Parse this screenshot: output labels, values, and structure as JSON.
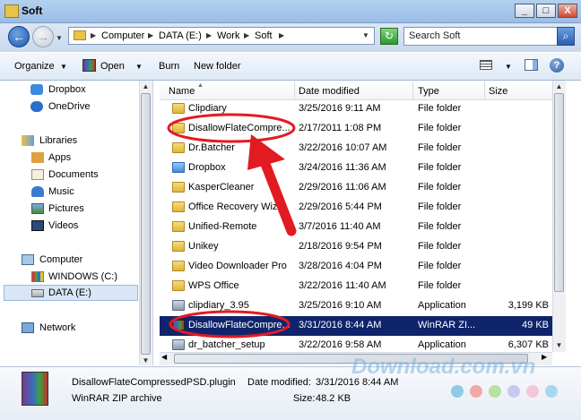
{
  "window": {
    "title": "Soft"
  },
  "titlebar_buttons": {
    "minimize": "_",
    "maximize": "□",
    "close": "X"
  },
  "address": {
    "breadcrumbs": [
      "Computer",
      "DATA (E:)",
      "Work",
      "Soft"
    ],
    "search_placeholder": "Search Soft"
  },
  "toolbar": {
    "organize": "Organize",
    "open": "Open",
    "burn": "Burn",
    "new_folder": "New folder",
    "help": "?"
  },
  "nav": {
    "favorites": [
      "Dropbox",
      "OneDrive"
    ],
    "libraries_label": "Libraries",
    "libraries": [
      "Apps",
      "Documents",
      "Music",
      "Pictures",
      "Videos"
    ],
    "computer_label": "Computer",
    "drives": [
      "WINDOWS (C:)",
      "DATA (E:)"
    ],
    "selected": "DATA (E:)",
    "network_label": "Network"
  },
  "columns": {
    "name": "Name",
    "date": "Date modified",
    "type": "Type",
    "size": "Size"
  },
  "files": [
    {
      "name": "Clipdiary",
      "date": "3/25/2016 9:11 AM",
      "type": "File folder",
      "size": "",
      "icon": "folder-icon"
    },
    {
      "name": "DisallowFlateCompre...",
      "date": "2/17/2011 1:08 PM",
      "type": "File folder",
      "size": "",
      "icon": "folder-icon"
    },
    {
      "name": "Dr.Batcher",
      "date": "3/22/2016 10:07 AM",
      "type": "File folder",
      "size": "",
      "icon": "folder-icon"
    },
    {
      "name": "Dropbox",
      "date": "3/24/2016 11:36 AM",
      "type": "File folder",
      "size": "",
      "icon": "dropbox-folder-icon"
    },
    {
      "name": "KasperCleaner",
      "date": "2/29/2016 11:06 AM",
      "type": "File folder",
      "size": "",
      "icon": "folder-icon"
    },
    {
      "name": "Office Recovery Wiz...",
      "date": "2/29/2016 5:44 PM",
      "type": "File folder",
      "size": "",
      "icon": "folder-icon"
    },
    {
      "name": "Unified-Remote",
      "date": "3/7/2016 11:40 AM",
      "type": "File folder",
      "size": "",
      "icon": "folder-icon"
    },
    {
      "name": "Unikey",
      "date": "2/18/2016 9:54 PM",
      "type": "File folder",
      "size": "",
      "icon": "folder-icon"
    },
    {
      "name": "Video Downloader Pro",
      "date": "3/28/2016 4:04 PM",
      "type": "File folder",
      "size": "",
      "icon": "folder-icon"
    },
    {
      "name": "WPS Office",
      "date": "3/22/2016 11:40 AM",
      "type": "File folder",
      "size": "",
      "icon": "folder-icon"
    },
    {
      "name": "clipdiary_3.95",
      "date": "3/25/2016 9:10 AM",
      "type": "Application",
      "size": "3,199 KB",
      "icon": "installer-icon"
    },
    {
      "name": "DisallowFlateCompre...",
      "date": "3/31/2016 8:44 AM",
      "type": "WinRAR ZI...",
      "size": "49 KB",
      "icon": "winrar-icon",
      "selected": true
    },
    {
      "name": "dr_batcher_setup",
      "date": "3/22/2016 9:58 AM",
      "type": "Application",
      "size": "6,307 KB",
      "icon": "installer-icon"
    }
  ],
  "details": {
    "filename": "DisallowFlateCompressedPSD.plugin",
    "date_label": "Date modified:",
    "date_value": "3/31/2016 8:44 AM",
    "type": "WinRAR ZIP archive",
    "size_label": "Size:",
    "size_value": "48.2 KB"
  },
  "watermark": "Download.com.vn",
  "colors": {
    "selection": "#10246b",
    "annotation": "#e21b23",
    "titlebar": "#b4d0ef",
    "watermark_dots": [
      "#8ecbe8",
      "#f2a8a8",
      "#b8e0a0",
      "#c9c9ef",
      "#f5c6d8",
      "#a8d8f0"
    ]
  }
}
